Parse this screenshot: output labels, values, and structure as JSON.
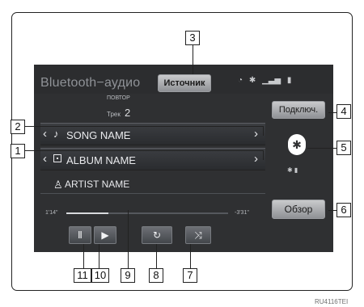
{
  "screen": {
    "title": "Bluetooth−аудио",
    "source_button": "Источник",
    "connect_button": "Подключ.",
    "browse_button": "Обзор",
    "repeat_label": "ПОВТОР",
    "track_label": "Трек",
    "track_number": "2",
    "song_name": "SONG NAME",
    "album_name": "ALBUM NAME",
    "artist_name": "ARTIST NAME",
    "elapsed_time": "1'14\"",
    "remaining_time": "-3'31\"",
    "progress_fraction": 0.26
  },
  "icons": {
    "wifi": "wifi-icon",
    "bluetooth": "bluetooth-icon",
    "signal": "signal-strength-icon",
    "battery": "battery-icon",
    "music_note": "music-note-icon",
    "album": "album-icon",
    "artist": "artist-icon",
    "pause": "pause-icon",
    "play": "play-icon",
    "repeat": "repeat-icon",
    "shuffle": "shuffle-icon"
  },
  "callouts": [
    "1",
    "2",
    "3",
    "4",
    "5",
    "6",
    "7",
    "8",
    "9",
    "10",
    "11"
  ],
  "watermark": "RU4116TEI",
  "colors": {
    "screen_background": "#2f3032",
    "button_light": "#c9cacc",
    "text_primary": "#e8e9ec"
  }
}
